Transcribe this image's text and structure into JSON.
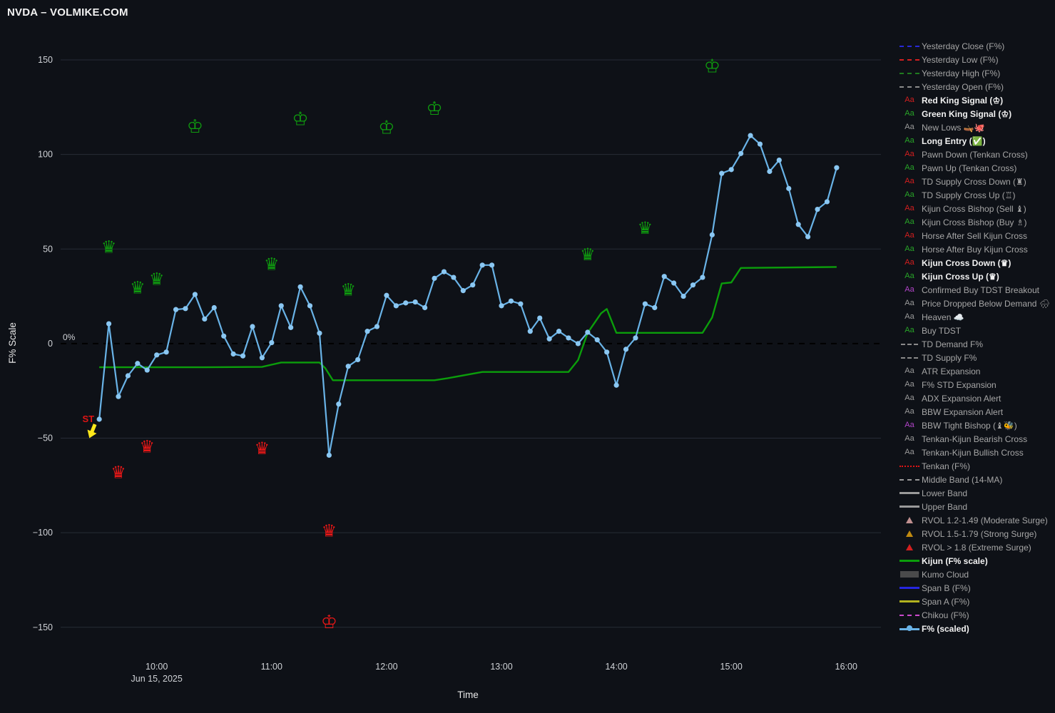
{
  "header": {
    "title": "NVDA – VOLMIKE.COM"
  },
  "axes": {
    "y_title": "F% Scale",
    "x_title": "Time",
    "y_ticks": [
      {
        "value": 150,
        "label": "150"
      },
      {
        "value": 100,
        "label": "100"
      },
      {
        "value": 50,
        "label": "50"
      },
      {
        "value": 0,
        "label": "0"
      },
      {
        "value": -50,
        "label": "−50"
      },
      {
        "value": -100,
        "label": "−100"
      },
      {
        "value": -150,
        "label": "−150"
      }
    ],
    "x_ticks": [
      {
        "time": "10:00",
        "label": "10:00"
      },
      {
        "time": "11:00",
        "label": "11:00"
      },
      {
        "time": "12:00",
        "label": "12:00"
      },
      {
        "time": "13:00",
        "label": "13:00"
      },
      {
        "time": "14:00",
        "label": "14:00"
      },
      {
        "time": "15:00",
        "label": "15:00"
      },
      {
        "time": "16:00",
        "label": "16:00"
      }
    ],
    "x_date_label": "Jun 15, 2025",
    "zero_line_label": "0%"
  },
  "annotations": {
    "start_label": "ST"
  },
  "colors": {
    "background": "#0e1117",
    "gridline": "#272c37",
    "zero_line": "#000000",
    "tick_text": "#cfd2d6",
    "axis_title": "#e8e8e8",
    "f_line": "#69b3e7",
    "f_marker": "#8ac7f2",
    "kijun_line": "#0b9e0b",
    "crown_green": "#0f9c0f",
    "crown_red": "#e81717",
    "st_label": "#e01414",
    "arrow_yellow": "#ffe81a"
  },
  "chart_data": {
    "type": "line",
    "title": "NVDA – VOLMIKE.COM",
    "xlabel": "Time",
    "ylabel": "F% Scale",
    "ylim": [
      -175,
      170
    ],
    "x_range": [
      "09:30",
      "15:55"
    ],
    "grid": true,
    "legend_position": "right",
    "series": [
      {
        "name": "F% (scaled)",
        "start_time": "09:30",
        "step_minutes": 5,
        "values": [
          -40,
          10.5,
          -28,
          -17,
          -10.5,
          -14,
          -6,
          -4.5,
          18,
          18.5,
          26,
          13,
          19,
          4,
          -5.5,
          -6.5,
          9,
          -7.5,
          0.5,
          20,
          8.5,
          30,
          20,
          5.5,
          -59,
          -32,
          -12,
          -8.5,
          6.5,
          9,
          25.5,
          20,
          21.5,
          22,
          19,
          34.5,
          38,
          35,
          28,
          31,
          41.5,
          41.5,
          20,
          22.5,
          21,
          6.5,
          13.5,
          2.5,
          6.5,
          3,
          0,
          6,
          2,
          -4.5,
          -22,
          -3,
          3,
          21,
          19,
          35.5,
          32,
          25,
          31,
          35,
          57.5,
          90,
          92,
          100.5,
          110,
          105.5,
          91,
          97,
          82,
          63,
          56.5,
          71,
          75,
          93
        ]
      },
      {
        "name": "Kijun (F% scale)",
        "points": [
          [
            "09:30",
            -12.5
          ],
          [
            "10:25",
            -12.5
          ],
          [
            "10:55",
            -12.3
          ],
          [
            "11:05",
            -10
          ],
          [
            "11:25",
            -10
          ],
          [
            "11:28",
            -13
          ],
          [
            "11:32",
            -19.4
          ],
          [
            "12:25",
            -19.4
          ],
          [
            "12:32",
            -18.3
          ],
          [
            "12:50",
            -15
          ],
          [
            "13:35",
            -15
          ],
          [
            "13:40",
            -8.7
          ],
          [
            "13:45",
            5.7
          ],
          [
            "13:52",
            16
          ],
          [
            "13:55",
            18.3
          ],
          [
            "14:00",
            5.7
          ],
          [
            "14:45",
            5.7
          ],
          [
            "14:50",
            13.8
          ],
          [
            "14:55",
            31.8
          ],
          [
            "15:00",
            32.3
          ],
          [
            "15:05",
            40
          ],
          [
            "15:55",
            40.5
          ]
        ]
      }
    ],
    "markers": {
      "green_queens": {
        "symbol": "♛",
        "points": [
          [
            "09:35",
            51
          ],
          [
            "09:50",
            29.5
          ],
          [
            "10:00",
            34
          ],
          [
            "11:00",
            42
          ],
          [
            "11:40",
            28.5
          ],
          [
            "13:45",
            47
          ],
          [
            "14:15",
            61
          ]
        ]
      },
      "green_kings": {
        "symbol": "♔",
        "points": [
          [
            "10:20",
            114.5
          ],
          [
            "11:15",
            118.5
          ],
          [
            "12:00",
            114
          ],
          [
            "12:25",
            124
          ],
          [
            "14:50",
            146.5
          ]
        ]
      },
      "red_queens": {
        "symbol": "♛",
        "points": [
          [
            "09:40",
            -68
          ],
          [
            "09:55",
            -54.5
          ],
          [
            "10:55",
            -55.5
          ],
          [
            "11:30",
            -99
          ]
        ]
      },
      "red_kings": {
        "symbol": "♔",
        "points": [
          [
            "11:30",
            -147.5
          ]
        ]
      },
      "start_annotation": {
        "time": "09:30",
        "value": -40,
        "label": "ST"
      }
    }
  },
  "legend": {
    "items": [
      {
        "label": "Yesterday Close (F%)",
        "swatch": "dash",
        "color": "#2929d6",
        "bold": false
      },
      {
        "label": "Yesterday Low (F%)",
        "swatch": "dash",
        "color": "#d32020",
        "bold": false
      },
      {
        "label": "Yesterday High (F%)",
        "swatch": "dash",
        "color": "#1f7a1f",
        "bold": false
      },
      {
        "label": "Yesterday Open (F%)",
        "swatch": "dash",
        "color": "#8c8c8c",
        "bold": false
      },
      {
        "label": "Red King Signal (♔)",
        "swatch": "aa",
        "color": "#d31f1f",
        "bold": true
      },
      {
        "label": "Green King Signal (♔)",
        "swatch": "aa",
        "color": "#28a428",
        "bold": true
      },
      {
        "label": "New Lows 🛶🐙",
        "swatch": "aa",
        "color": "#9a9a9a",
        "bold": false
      },
      {
        "label": "Long Entry (✅)",
        "swatch": "aa",
        "color": "#28a428",
        "bold": true
      },
      {
        "label": "Pawn Down (Tenkan Cross)",
        "swatch": "aa",
        "color": "#d31f1f",
        "bold": false
      },
      {
        "label": "Pawn Up (Tenkan Cross)",
        "swatch": "aa",
        "color": "#28a428",
        "bold": false
      },
      {
        "label": "TD Supply Cross Down (♜)",
        "swatch": "aa",
        "color": "#d31f1f",
        "bold": false
      },
      {
        "label": "TD Supply Cross Up (♖)",
        "swatch": "aa",
        "color": "#28a428",
        "bold": false
      },
      {
        "label": "Kijun Cross Bishop (Sell ♝)",
        "swatch": "aa",
        "color": "#d31f1f",
        "bold": false
      },
      {
        "label": "Kijun Cross Bishop (Buy ♗)",
        "swatch": "aa",
        "color": "#28a428",
        "bold": false
      },
      {
        "label": "Horse After Sell Kijun Cross",
        "swatch": "aa",
        "color": "#d31f1f",
        "bold": false
      },
      {
        "label": "Horse After Buy Kijun Cross",
        "swatch": "aa",
        "color": "#28a428",
        "bold": false
      },
      {
        "label": "Kijun Cross Down (♛)",
        "swatch": "aa",
        "color": "#d31f1f",
        "bold": true
      },
      {
        "label": "Kijun Cross Up (♛)",
        "swatch": "aa",
        "color": "#28a428",
        "bold": true
      },
      {
        "label": "Confirmed Buy TDST Breakout",
        "swatch": "aa",
        "color": "#b144c8",
        "bold": false
      },
      {
        "label": "Price Dropped Below Demand 🌧",
        "swatch": "aa",
        "color": "#9a9a9a",
        "bold": false
      },
      {
        "label": "Heaven ☁️",
        "swatch": "aa",
        "color": "#9a9a9a",
        "bold": false
      },
      {
        "label": "Buy TDST",
        "swatch": "aa",
        "color": "#28a428",
        "bold": false
      },
      {
        "label": "TD Demand F%",
        "swatch": "dashsm",
        "color": "#8a8a8a",
        "bold": false
      },
      {
        "label": "TD Supply F%",
        "swatch": "dashsm",
        "color": "#8a8a8a",
        "bold": false
      },
      {
        "label": "ATR Expansion",
        "swatch": "aa",
        "color": "#9a9a9a",
        "bold": false
      },
      {
        "label": "F% STD Expansion",
        "swatch": "aa",
        "color": "#9a9a9a",
        "bold": false
      },
      {
        "label": "ADX Expansion Alert",
        "swatch": "aa",
        "color": "#9a9a9a",
        "bold": false
      },
      {
        "label": "BBW Expansion Alert",
        "swatch": "aa",
        "color": "#9a9a9a",
        "bold": false
      },
      {
        "label": "BBW Tight Bishop (♝🐝)",
        "swatch": "aa",
        "color": "#b144c8",
        "bold": false
      },
      {
        "label": "Tenkan-Kijun Bearish Cross",
        "swatch": "aa",
        "color": "#9a9a9a",
        "bold": false
      },
      {
        "label": "Tenkan-Kijun Bullish Cross",
        "swatch": "aa",
        "color": "#9a9a9a",
        "bold": false
      },
      {
        "label": "Tenkan (F%)",
        "swatch": "dot",
        "color": "#e01414",
        "bold": false
      },
      {
        "label": "Middle Band (14-MA)",
        "swatch": "dash",
        "color": "#999999",
        "bold": false
      },
      {
        "label": "Lower Band",
        "swatch": "solid",
        "color": "#9a9a9a",
        "bold": false
      },
      {
        "label": "Upper Band",
        "swatch": "solid",
        "color": "#9a9a9a",
        "bold": false
      },
      {
        "label": "RVOL 1.2-1.49 (Moderate Surge)",
        "swatch": "tri",
        "color": "#c09090",
        "bold": false
      },
      {
        "label": "RVOL 1.5-1.79 (Strong Surge)",
        "swatch": "tri",
        "color": "#c08a10",
        "bold": false
      },
      {
        "label": "RVOL > 1.8 (Extreme Surge)",
        "swatch": "tri",
        "color": "#d21f1f",
        "bold": false
      },
      {
        "label": "Kijun (F% scale)",
        "swatch": "solid",
        "color": "#0b9e0b",
        "bold": true
      },
      {
        "label": "Kumo Cloud",
        "swatch": "kumo",
        "color": "#555555",
        "bold": false
      },
      {
        "label": "Span B (F%)",
        "swatch": "solid",
        "color": "#2626e0",
        "bold": false
      },
      {
        "label": "Span A (F%)",
        "swatch": "solid",
        "color": "#b2b21f",
        "bold": false
      },
      {
        "label": "Chikou (F%)",
        "swatch": "dash",
        "color": "#cc49cc",
        "bold": false
      },
      {
        "label": "F% (scaled)",
        "swatch": "markerline",
        "color": "#69b3e7",
        "bold": true
      }
    ]
  }
}
